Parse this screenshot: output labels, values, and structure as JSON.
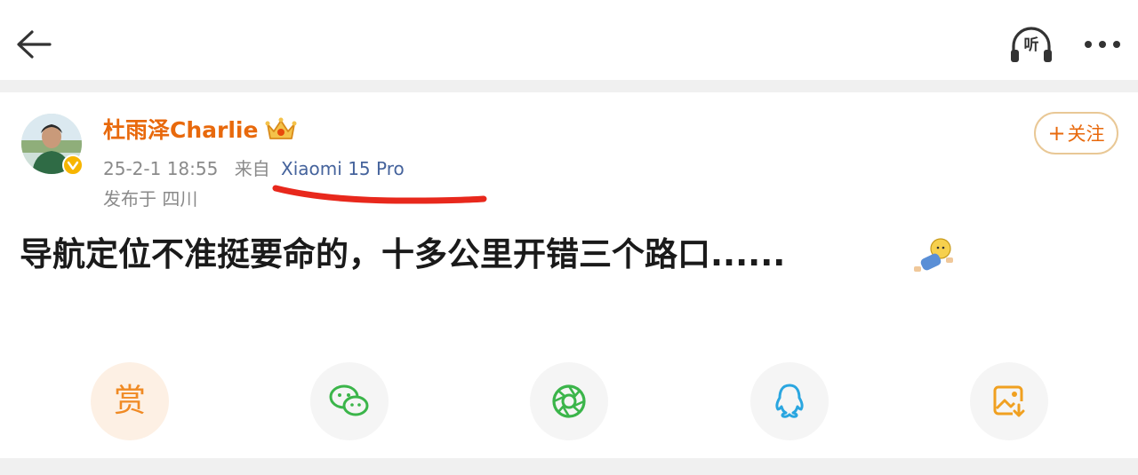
{
  "header": {
    "back_icon": "arrow-left-icon",
    "listen_label": "听",
    "more_icon": "ellipsis-icon"
  },
  "post": {
    "author": {
      "name": "杜雨泽Charlie",
      "badge_icon": "crown-icon",
      "verified_icon": "verified-badge-icon"
    },
    "timestamp": "25-2-1 18:55",
    "source_prefix": "来自",
    "device": "Xiaomi 15 Pro",
    "location": "发布于 四川",
    "follow_label": "关注",
    "text": "导航定位不准挺要命的，十多公里开错三个路口......",
    "emoji_icon": "doge-sleeping-emoji-icon"
  },
  "share_bar": {
    "reward_label": "赏",
    "buttons": [
      "reward-icon",
      "wechat-icon",
      "moments-icon",
      "qq-icon",
      "save-image-icon"
    ]
  },
  "colors": {
    "username": "#e8690c",
    "device_link": "#45639c",
    "meta_gray": "#8a8a8a",
    "annotation_red": "#e8281c",
    "follow_border": "#e9c896"
  }
}
